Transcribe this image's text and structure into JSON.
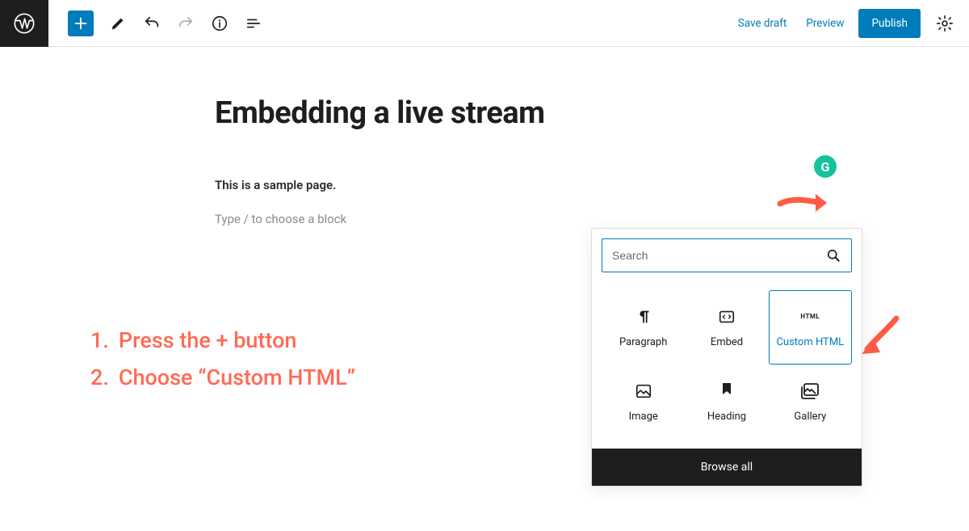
{
  "toolbar": {
    "save_draft": "Save draft",
    "preview": "Preview",
    "publish": "Publish"
  },
  "editor": {
    "title": "Embedding a live stream",
    "sample": "This is a sample page.",
    "placeholder": "Type / to choose a block"
  },
  "grammarly": {
    "letter": "G"
  },
  "inserter": {
    "search_placeholder": "Search",
    "blocks": [
      {
        "label": "Paragraph"
      },
      {
        "label": "Embed"
      },
      {
        "label": "Custom HTML",
        "html_badge": "HTML"
      },
      {
        "label": "Image"
      },
      {
        "label": "Heading"
      },
      {
        "label": "Gallery"
      }
    ],
    "browse_all": "Browse all"
  },
  "instructions": {
    "step1_num": "1.",
    "step1_text": "Press the + button",
    "step2_num": "2.",
    "step2_text": "Choose “Custom HTML”"
  }
}
